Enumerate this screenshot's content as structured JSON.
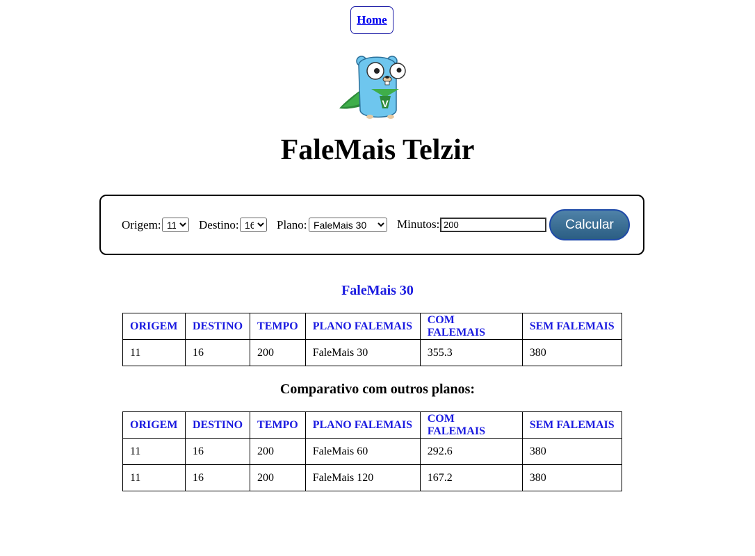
{
  "nav": {
    "home_label": "Home"
  },
  "page": {
    "title": "FaleMais Telzir"
  },
  "form": {
    "origem_label": "Origem:",
    "origem_value": "11",
    "destino_label": "Destino:",
    "destino_value": "16",
    "plano_label": "Plano:",
    "plano_value": "FaleMais 30",
    "minutos_label": "Minutos:",
    "minutos_value": "200",
    "calcular_label": "Calcular"
  },
  "result": {
    "plan_title": "FaleMais 30",
    "headers": [
      "ORIGEM",
      "DESTINO",
      "TEMPO",
      "PLANO FALEMAIS",
      "COM FALEMAIS",
      "SEM FALEMAIS"
    ],
    "rows": [
      [
        "11",
        "16",
        "200",
        "FaleMais 30",
        "355.3",
        "380"
      ]
    ]
  },
  "comparison": {
    "title": "Comparativo com outros planos:",
    "headers": [
      "ORIGEM",
      "DESTINO",
      "TEMPO",
      "PLANO FALEMAIS",
      "COM FALEMAIS",
      "SEM FALEMAIS"
    ],
    "rows": [
      [
        "11",
        "16",
        "200",
        "FaleMais 60",
        "292.6",
        "380"
      ],
      [
        "11",
        "16",
        "200",
        "FaleMais 120",
        "167.2",
        "380"
      ]
    ]
  }
}
